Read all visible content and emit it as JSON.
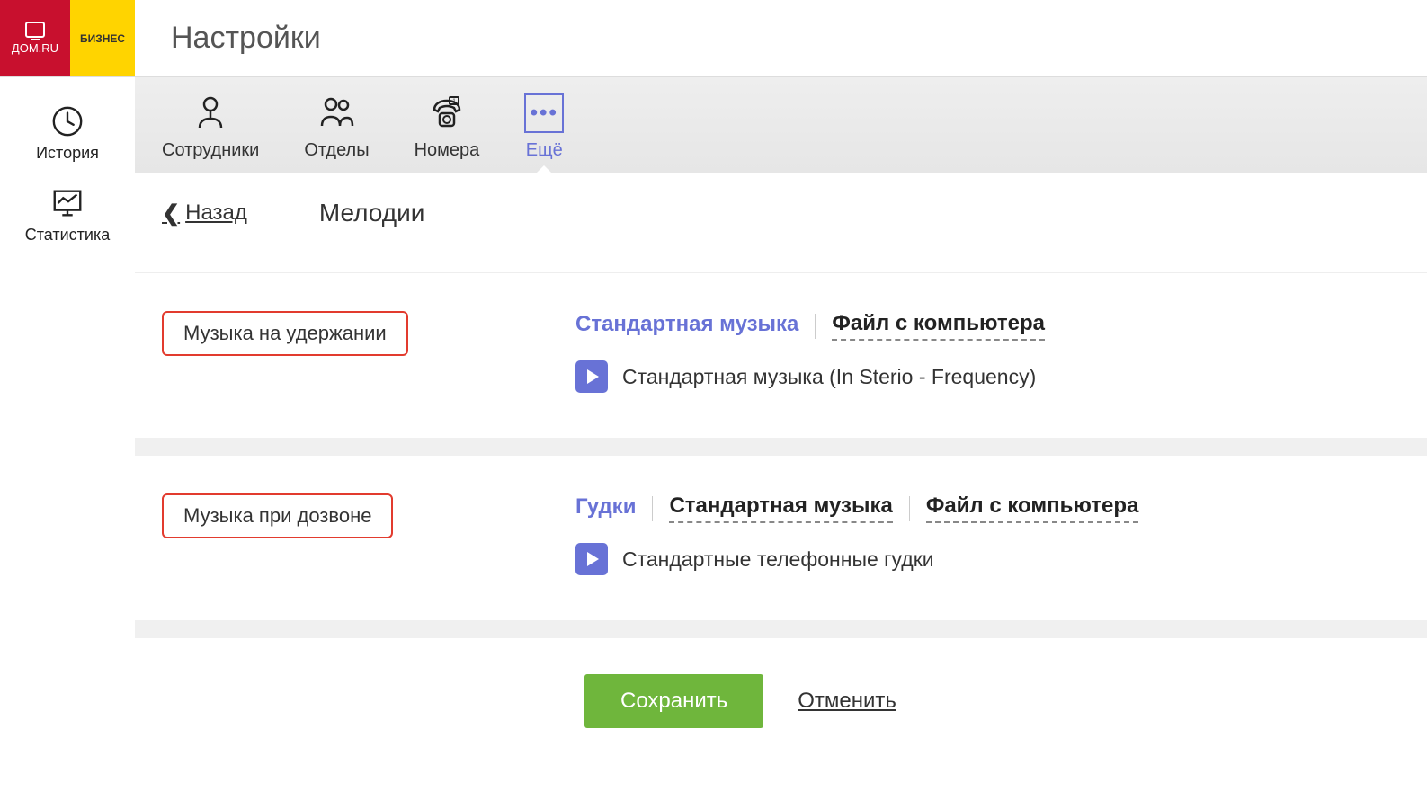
{
  "logo": {
    "brand": "ДОМ.RU",
    "sub": "БИЗНЕС"
  },
  "page_title": "Настройки",
  "sidebar": {
    "items": [
      {
        "label": "История"
      },
      {
        "label": "Статистика"
      }
    ]
  },
  "tabs": [
    {
      "label": "Сотрудники"
    },
    {
      "label": "Отделы"
    },
    {
      "label": "Номера"
    },
    {
      "label": "Ещё"
    }
  ],
  "back_label": "Назад",
  "section_title": "Мелодии",
  "hold_music": {
    "label": "Музыка на удержании",
    "options": [
      "Стандартная музыка",
      "Файл с компьютера"
    ],
    "track": "Стандартная музыка (In Sterio - Frequency)"
  },
  "dial_music": {
    "label": "Музыка при дозвоне",
    "options": [
      "Гудки",
      "Стандартная музыка",
      "Файл с компьютера"
    ],
    "track": "Стандартные телефонные гудки"
  },
  "actions": {
    "save": "Сохранить",
    "cancel": "Отменить"
  }
}
